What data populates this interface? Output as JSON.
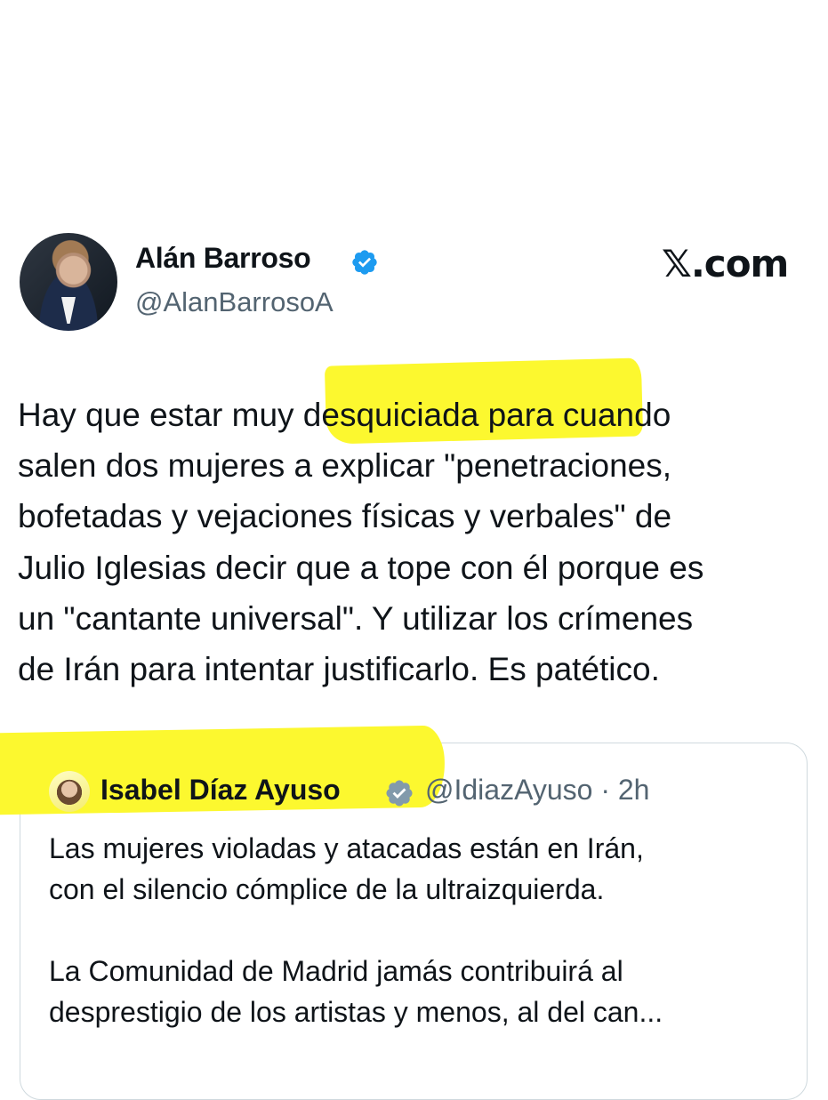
{
  "site": "𝕏.com",
  "tweet": {
    "author_name": "Alán Barroso",
    "handle": "@AlanBarrosoA",
    "lines": [
      "Hay que estar muy desquiciada para cuando",
      "salen dos mujeres a explicar \"penetraciones,",
      "bofetadas y vejaciones físicas y verbales\" de",
      "Julio Iglesias decir que a tope con él porque es",
      "un \"cantante universal\". Y utilizar los crímenes",
      "de Irán para intentar justificarlo. Es patético."
    ]
  },
  "quoted": {
    "author_name": "Isabel Díaz Ayuso",
    "handle": "@IdiazAyuso",
    "time": "· 2h",
    "lines": [
      "Las mujeres violadas y atacadas están en Irán,",
      "con el silencio cómplice de la ultraizquierda."
    ],
    "lines2": [
      "La Comunidad de Madrid jamás contribuirá al",
      "desprestigio de los artistas y menos, al del can..."
    ]
  },
  "colors": {
    "verified_blue": "#1d9bf0",
    "highlight_yellow": "#fcf82f",
    "gov_badge_gray": "#829aab",
    "secondary_text": "#536471"
  }
}
